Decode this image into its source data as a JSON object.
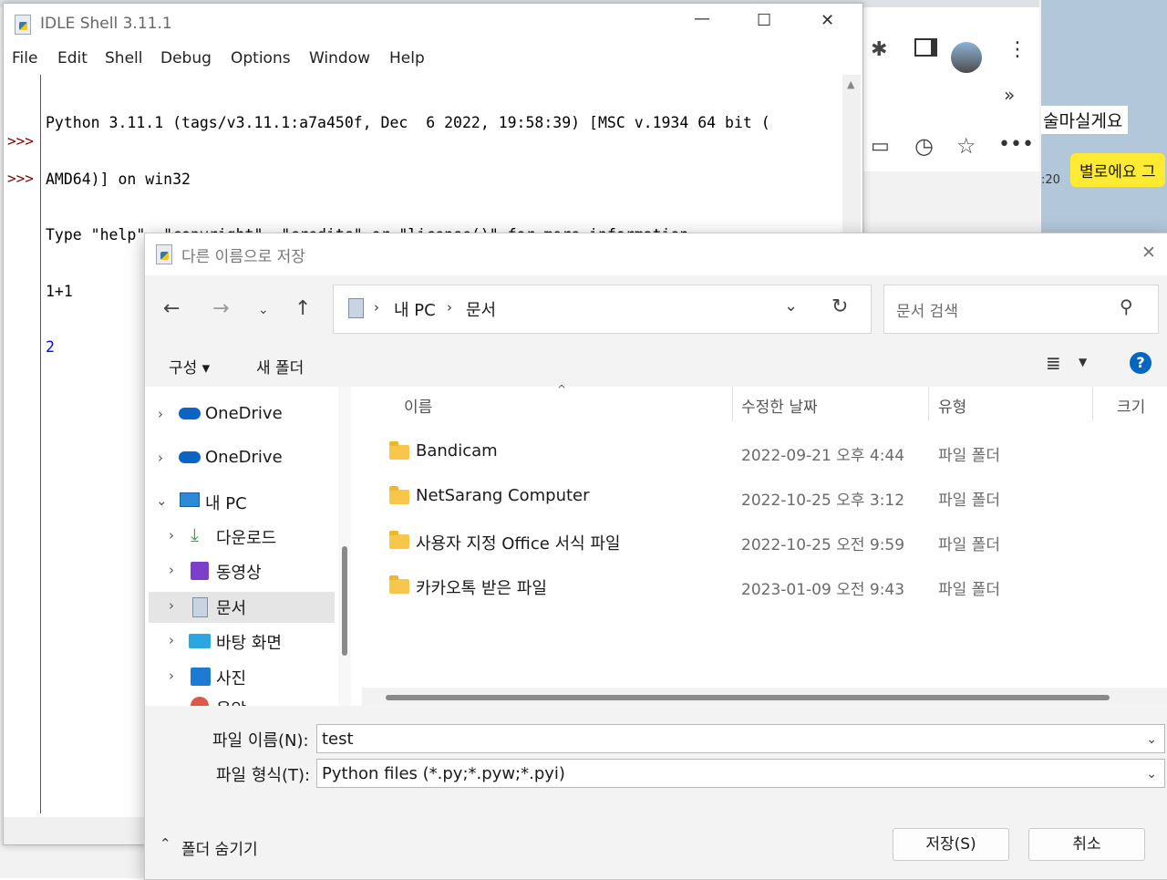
{
  "idle": {
    "title": "IDLE Shell 3.11.1",
    "menu": [
      "File",
      "Edit",
      "Shell",
      "Debug",
      "Options",
      "Window",
      "Help"
    ],
    "output_lines": [
      "Python 3.11.1 (tags/v3.11.1:a7a450f, Dec  6 2022, 19:58:39) [MSC v.1934 64 bit (",
      "AMD64)] on win32",
      "Type \"help\", \"copyright\", \"credits\" or \"license()\" for more information.",
      "1+1",
      "2"
    ],
    "prompt": ">>>",
    "minimize": "—",
    "maximize": "☐",
    "close": "✕"
  },
  "browser": {
    "chat_text_1": "술마실게요",
    "chat_time": ":20",
    "chat_bubble": "별로에요 그",
    "more_chevron": "»"
  },
  "dialog": {
    "title": "다른 이름으로 저장",
    "breadcrumb": [
      "내 PC",
      "문서"
    ],
    "search_placeholder": "문서 검색",
    "organize_label": "구성 ▾",
    "new_folder_label": "새 폴더",
    "help_label": "?",
    "nav_items": [
      {
        "label": "OneDrive",
        "icon": "cloud-icon",
        "expanded": false,
        "level": 0
      },
      {
        "label": "OneDrive",
        "icon": "cloud-icon",
        "expanded": false,
        "level": 0
      },
      {
        "label": "내 PC",
        "icon": "pc-icon",
        "expanded": true,
        "level": 0
      },
      {
        "label": "다운로드",
        "icon": "download-icon",
        "expanded": false,
        "level": 1
      },
      {
        "label": "동영상",
        "icon": "video-icon",
        "expanded": false,
        "level": 1
      },
      {
        "label": "문서",
        "icon": "document-icon",
        "expanded": false,
        "level": 1,
        "selected": true
      },
      {
        "label": "바탕 화면",
        "icon": "desktop-icon",
        "expanded": false,
        "level": 1
      },
      {
        "label": "사진",
        "icon": "picture-icon",
        "expanded": false,
        "level": 1
      },
      {
        "label": "음악",
        "icon": "music-icon",
        "expanded": false,
        "level": 1
      }
    ],
    "columns": [
      "이름",
      "수정한 날짜",
      "유형",
      "크기"
    ],
    "files": [
      {
        "name": "Bandicam",
        "date": "2022-09-21 오후 4:44",
        "type": "파일 폴더"
      },
      {
        "name": "NetSarang Computer",
        "date": "2022-10-25 오후 3:12",
        "type": "파일 폴더"
      },
      {
        "name": "사용자 지정 Office 서식 파일",
        "date": "2022-10-25 오전 9:59",
        "type": "파일 폴더"
      },
      {
        "name": "카카오톡 받은 파일",
        "date": "2023-01-09 오전 9:43",
        "type": "파일 폴더"
      }
    ],
    "filename_label": "파일 이름(N):",
    "filename_value": "test",
    "filetype_label": "파일 형식(T):",
    "filetype_value": "Python files (*.py;*.pyw;*.pyi)",
    "hide_folders_label": "폴더 숨기기",
    "save_label": "저장(S)",
    "cancel_label": "취소",
    "close": "✕"
  },
  "colors": {
    "accent": "#0067c0",
    "prompt": "#7a0000",
    "result": "#0000ff",
    "folder": "#f8c64b",
    "chat_bubble": "#ffeb33"
  }
}
